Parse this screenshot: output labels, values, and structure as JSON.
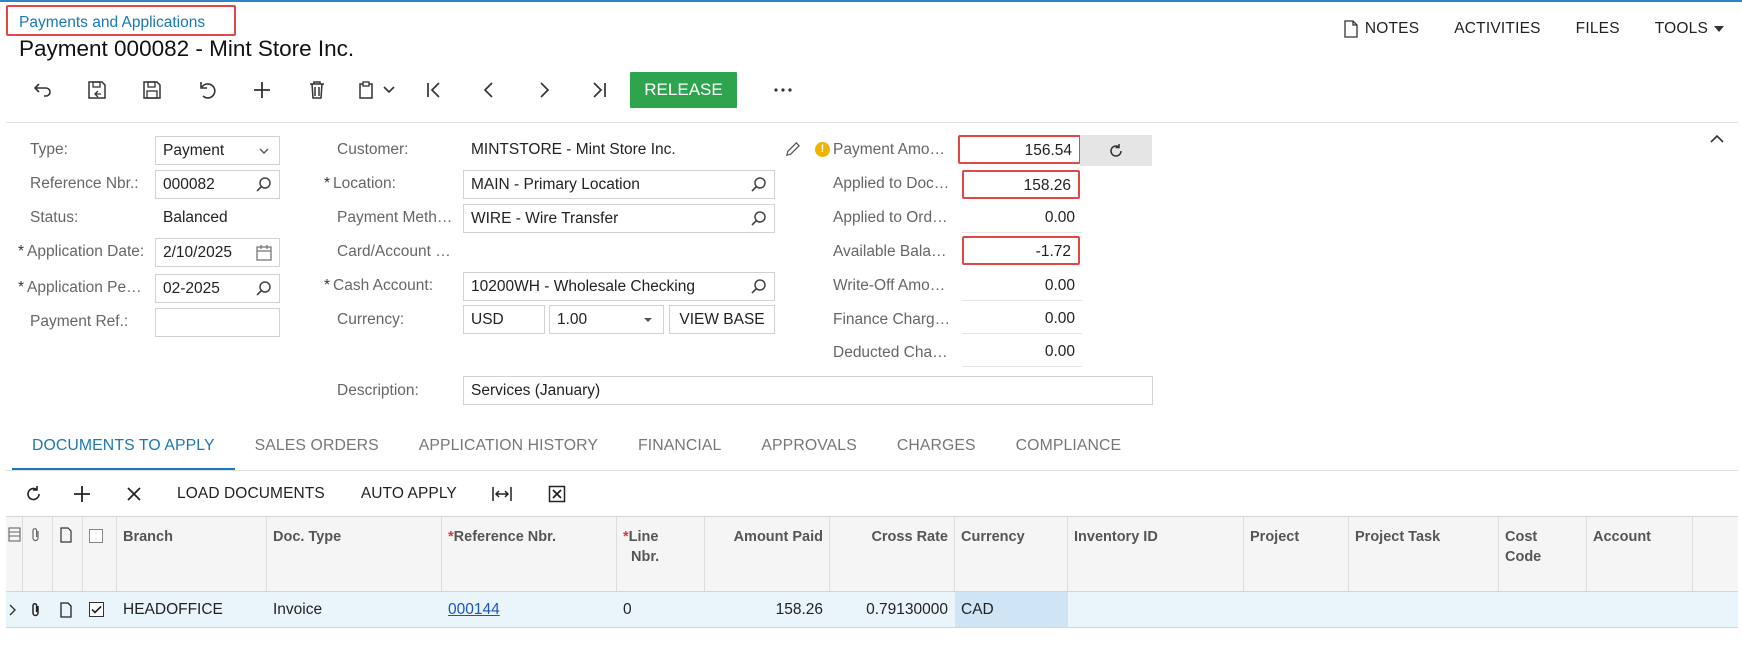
{
  "breadcrumb": "Payments and Applications",
  "title": "Payment 000082 - Mint Store Inc.",
  "topmenu": {
    "notes": "NOTES",
    "activities": "ACTIVITIES",
    "files": "FILES",
    "tools": "TOOLS"
  },
  "toolbar": {
    "release": "RELEASE"
  },
  "form": {
    "type_label": "Type:",
    "type_value": "Payment",
    "refnbr_label": "Reference Nbr.:",
    "refnbr_value": "000082",
    "status_label": "Status:",
    "status_value": "Balanced",
    "appdate_label": "Application Date:",
    "appdate_value": "2/10/2025",
    "appperiod_label": "Application Pe…",
    "appperiod_value": "02-2025",
    "payref_label": "Payment Ref.:",
    "payref_value": "",
    "customer_label": "Customer:",
    "customer_value": "MINTSTORE - Mint Store Inc.",
    "location_label": "Location:",
    "location_value": "MAIN - Primary Location",
    "paymethod_label": "Payment Meth…",
    "paymethod_value": "WIRE - Wire Transfer",
    "card_label": "Card/Account …",
    "cash_label": "Cash Account:",
    "cash_value": "10200WH - Wholesale Checking",
    "currency_label": "Currency:",
    "currency_value": "USD",
    "rate_value": "1.00",
    "viewbase": "VIEW BASE",
    "desc_label": "Description:",
    "desc_value": "Services (January)",
    "payamt_label": "Payment Amo…",
    "payamt_value": "156.54",
    "applied_doc_label": "Applied to Doc…",
    "applied_doc_value": "158.26",
    "applied_ord_label": "Applied to Ord…",
    "applied_ord_value": "0.00",
    "avail_label": "Available Bala…",
    "avail_value": "-1.72",
    "writeoff_label": "Write-Off Amo…",
    "writeoff_value": "0.00",
    "finance_label": "Finance Charg…",
    "finance_value": "0.00",
    "deducted_label": "Deducted Cha…",
    "deducted_value": "0.00"
  },
  "tabs": [
    "DOCUMENTS TO APPLY",
    "SALES ORDERS",
    "APPLICATION HISTORY",
    "FINANCIAL",
    "APPROVALS",
    "CHARGES",
    "COMPLIANCE"
  ],
  "gridtool": {
    "load": "LOAD DOCUMENTS",
    "auto": "AUTO APPLY"
  },
  "grid": {
    "headers": {
      "branch": "Branch",
      "doctype": "Doc. Type",
      "refnbr": "Reference Nbr.",
      "linenbr1": "Line",
      "linenbr2": "Nbr.",
      "amount": "Amount Paid",
      "rate": "Cross Rate",
      "currency": "Currency",
      "inventory": "Inventory ID",
      "project": "Project",
      "task": "Project Task",
      "cost1": "Cost",
      "cost2": "Code",
      "account": "Account"
    },
    "row": {
      "branch": "HEADOFFICE",
      "doctype": "Invoice",
      "refnbr": "000144",
      "linenbr": "0",
      "amount": "158.26",
      "rate": "0.79130000",
      "currency": "CAD"
    }
  }
}
